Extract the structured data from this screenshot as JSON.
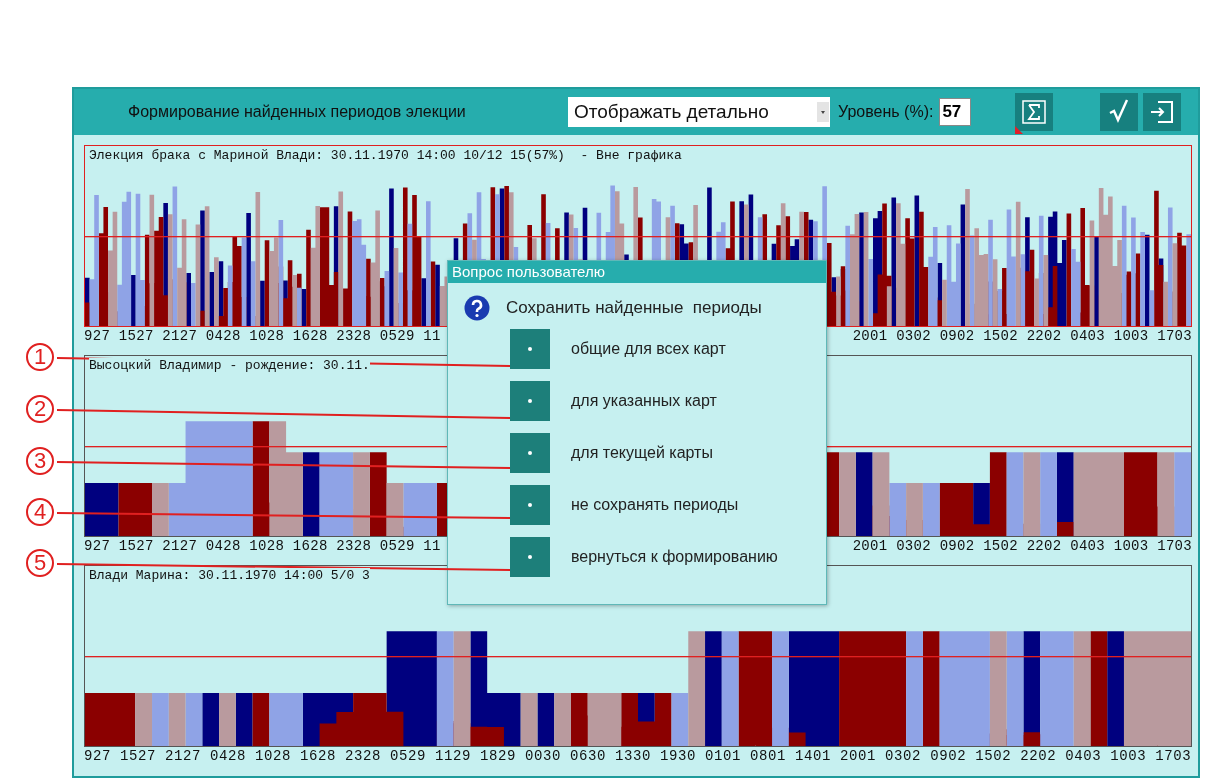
{
  "window": {
    "title": "Формирование найденных периодов элекции"
  },
  "toolbar": {
    "display_mode": "Отображать детально",
    "level_label": "Уровень (%):",
    "level_value": "57"
  },
  "panels": [
    {
      "title": "Элекция брака с Мариной Влади: 30.11.1970 14:00 10/12 15(57%)  - Вне графика",
      "axis_labels": [
        "927 1527 2127 0428 1028 1628 2328 0529 11",
        "2001 0302 0902 1502 2202 0403 1003 1703"
      ]
    },
    {
      "title": "Высоцкий Владимир - рождение: 30.11.",
      "axis_labels": [
        "927 1527 2127 0428 1028 1628 2328 0529 11",
        "2001 0302 0902 1502 2202 0403 1003 1703"
      ]
    },
    {
      "title": "Влади Марина: 30.11.1970 14:00 5/0 3",
      "axis_labels": [
        "927 1527 2127 0428 1028 1628 2328 0529 1129 1829 0030 0630 1330 1930 0101 0801 1401 2001 0302 0902 1502 2202 0403 1003 1703"
      ]
    }
  ],
  "dialog": {
    "title": "Вопрос пользователю",
    "question": "Сохранить найденные  периоды",
    "options": [
      {
        "number": "1",
        "label": "общие для всех карт"
      },
      {
        "number": "2",
        "label": "для указанных карт"
      },
      {
        "number": "3",
        "label": "для текущей карты"
      },
      {
        "number": "4",
        "label": "не сохранять периоды"
      },
      {
        "number": "5",
        "label": "вернуться к формированию"
      }
    ]
  }
}
